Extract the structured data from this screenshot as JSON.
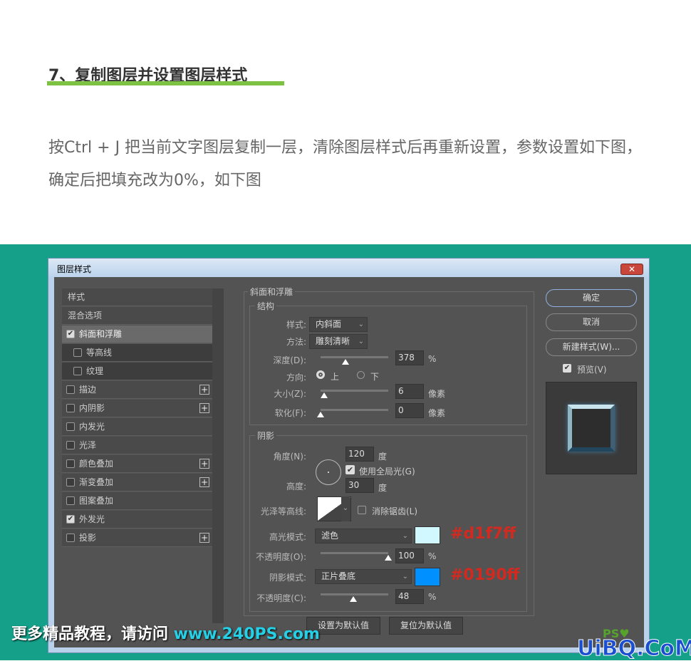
{
  "article": {
    "heading": "7、复制图层并设置图层样式",
    "paragraph": "按Ctrl + J 把当前文字图层复制一层，清除图层样式后再重新设置，参数设置如下图，确定后把填充改为0%，如下图"
  },
  "dialog": {
    "title": "图层样式",
    "close": "✕",
    "sidebar": [
      {
        "label": "样式",
        "checkbox": null,
        "plus": false
      },
      {
        "label": "混合选项",
        "checkbox": null,
        "plus": false
      },
      {
        "label": "斜面和浮雕",
        "checkbox": true,
        "plus": false,
        "selected": true
      },
      {
        "label": "等高线",
        "checkbox": false,
        "plus": false,
        "sub": true
      },
      {
        "label": "纹理",
        "checkbox": false,
        "plus": false,
        "sub": true
      },
      {
        "label": "描边",
        "checkbox": false,
        "plus": true
      },
      {
        "label": "内阴影",
        "checkbox": false,
        "plus": true
      },
      {
        "label": "内发光",
        "checkbox": false,
        "plus": false
      },
      {
        "label": "光泽",
        "checkbox": false,
        "plus": false
      },
      {
        "label": "颜色叠加",
        "checkbox": false,
        "plus": true
      },
      {
        "label": "渐变叠加",
        "checkbox": false,
        "plus": true
      },
      {
        "label": "图案叠加",
        "checkbox": false,
        "plus": false
      },
      {
        "label": "外发光",
        "checkbox": true,
        "plus": false
      },
      {
        "label": "投影",
        "checkbox": false,
        "plus": true
      }
    ],
    "bevel": {
      "legend": "斜面和浮雕",
      "structure": "结构",
      "style_label": "样式:",
      "style_value": "内斜面",
      "technique_label": "方法:",
      "technique_value": "雕刻清晰",
      "depth_label": "深度(D):",
      "depth_value": "378",
      "depth_unit": "%",
      "direction_label": "方向:",
      "dir_up": "上",
      "dir_down": "下",
      "direction": "上",
      "size_label": "大小(Z):",
      "size_value": "6",
      "size_unit": "像素",
      "soften_label": "软化(F):",
      "soften_value": "0",
      "soften_unit": "像素"
    },
    "shading": {
      "legend": "阴影",
      "angle_label": "角度(N):",
      "angle_value": "120",
      "angle_unit": "度",
      "global_light": "使用全局光(G)",
      "global_light_checked": true,
      "altitude_label": "高度:",
      "altitude_value": "30",
      "altitude_unit": "度",
      "gloss_label": "光泽等高线:",
      "antialias": "消除锯齿(L)",
      "antialias_checked": false,
      "highlight_label": "高光模式:",
      "highlight_mode": "滤色",
      "highlight_color": "#d1f7ff",
      "highlight_hex": "#d1f7ff",
      "hl_opacity_label": "不透明度(O):",
      "hl_opacity": "100",
      "pct": "%",
      "shadow_label": "阴影模式:",
      "shadow_mode": "正片叠底",
      "shadow_color": "#0190ff",
      "shadow_hex": "#0190ff",
      "sh_opacity_label": "不透明度(C):",
      "sh_opacity": "48"
    },
    "make_default": "设置为默认值",
    "reset_default": "复位为默认值",
    "ok": "确定",
    "cancel": "取消",
    "new_style": "新建样式(W)...",
    "preview": "预览(V)",
    "preview_checked": true
  },
  "watermark": {
    "text": "更多精品教程，请访问 ",
    "url": "www.240PS.com",
    "logo1": "PS爱好者",
    "logo2": "UiBQ.CoM"
  }
}
